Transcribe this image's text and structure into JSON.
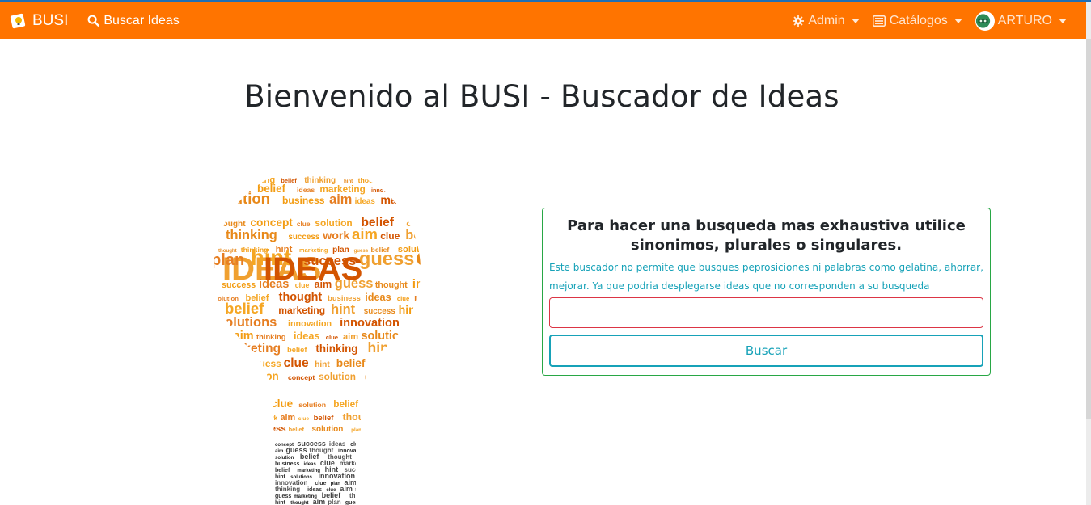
{
  "navbar": {
    "brand": "BUSI",
    "search_link": "Buscar Ideas",
    "admin": "Admin",
    "catalogos": "Catálogos",
    "user": "ARTURO"
  },
  "page": {
    "title": "Bienvenido al BUSI - Buscador de Ideas"
  },
  "search_panel": {
    "heading": "Para hacer una busqueda mas exhaustiva utilice sinonimos, plurales o singulares.",
    "help": "Este buscador no permite que busques peprosiciones ni palabras como gelatina, ahorrar, mejorar. Ya que podria desplegarse ideas que no corresponden a su busqueda",
    "input_value": "",
    "button_label": "Buscar"
  },
  "wordcloud": {
    "words": [
      "guess",
      "marketing",
      "belief",
      "thinking",
      "hint",
      "thought",
      "aim",
      "plan",
      "guess",
      "clue",
      "hint",
      "belief",
      "ideas",
      "marketing",
      "innovation",
      "concept",
      "solution",
      "business",
      "aim",
      "ideas",
      "marketing",
      "IDEAS",
      "thought",
      "concept",
      "clue",
      "solution",
      "belief",
      "concept",
      "thinking",
      "success",
      "work",
      "aim",
      "clue",
      "belief",
      "thought",
      "thinking",
      "hint",
      "marketing",
      "plan",
      "guess",
      "belief",
      "solution",
      "plan",
      "hint",
      "success",
      "guess",
      "concept",
      "success",
      "ideas",
      "clue",
      "aim",
      "guess",
      "thought",
      "innovation",
      "solution",
      "belief",
      "thought",
      "business",
      "ideas",
      "clue",
      "marketing",
      "belief",
      "marketing",
      "hint",
      "success",
      "hint",
      "solutions",
      "innovation",
      "innovation",
      "clue",
      "plan",
      "aim",
      "thinking",
      "ideas",
      "clue",
      "aim",
      "solution"
    ]
  },
  "colors": {
    "navbar": "#ff7400",
    "success_border": "#28a745",
    "info": "#17a2b8",
    "danger": "#dc3545"
  }
}
